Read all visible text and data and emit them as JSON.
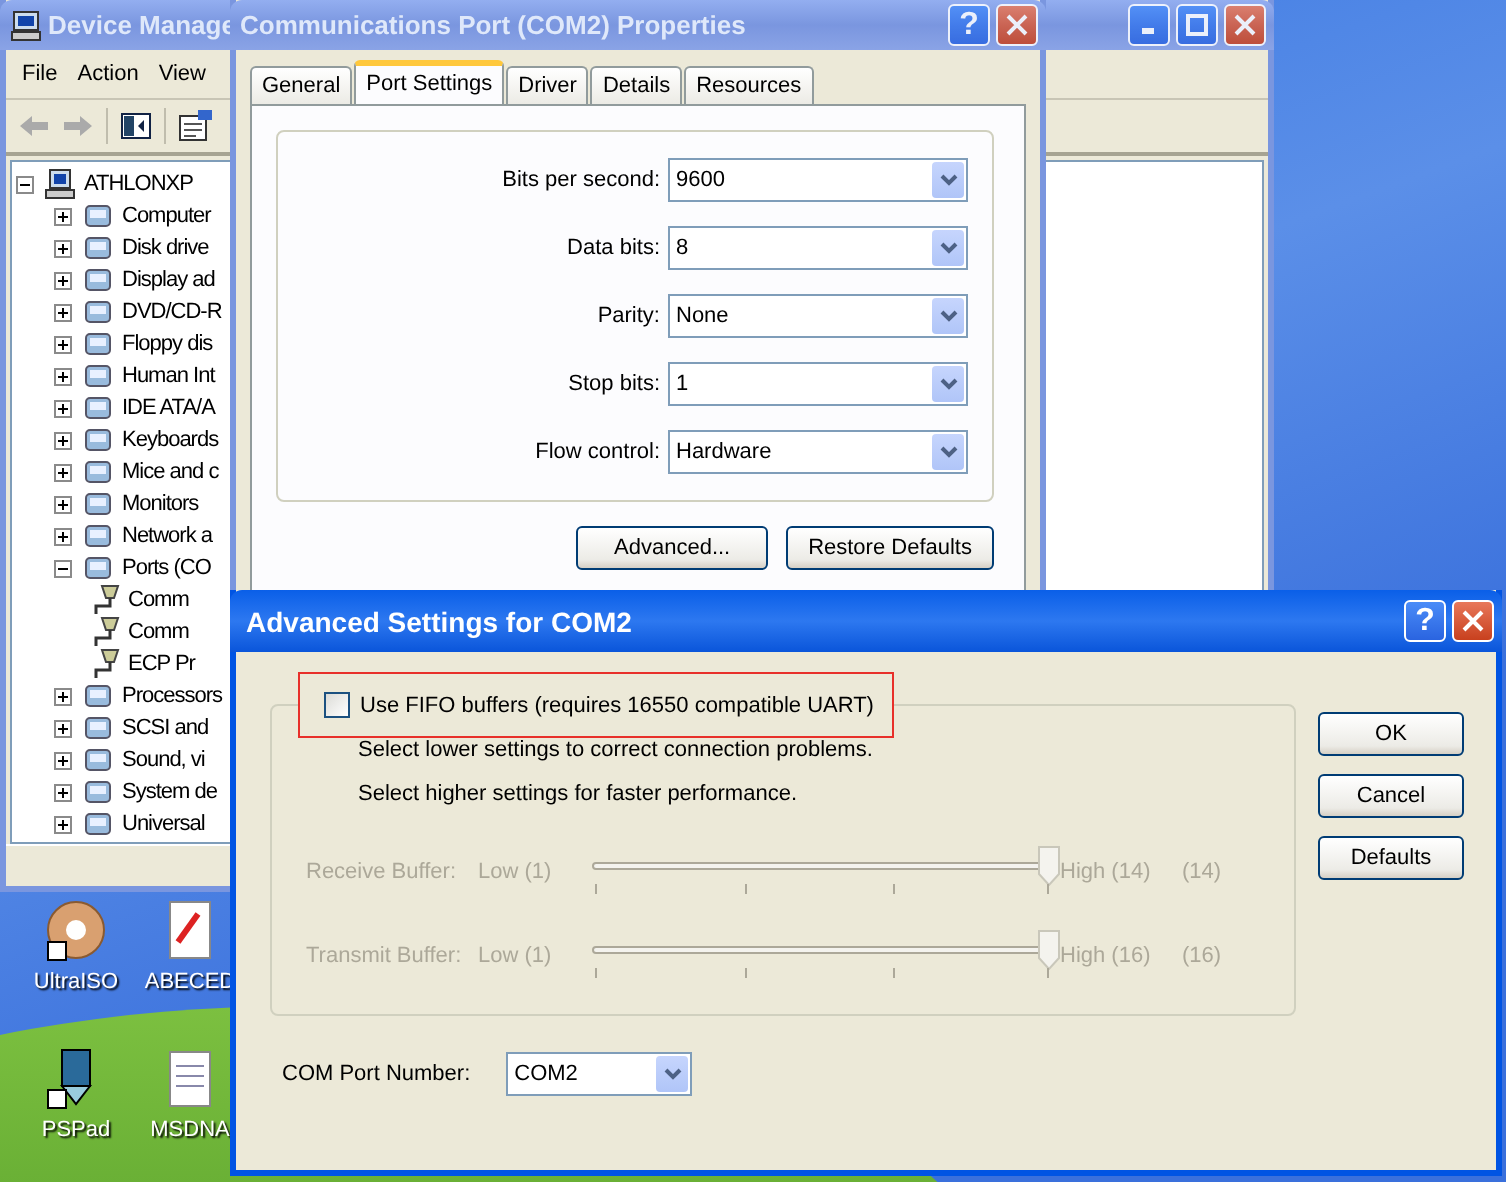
{
  "desktop": {
    "icons": [
      {
        "label": "UltraISO",
        "kind": "disc"
      },
      {
        "label": "ABECED",
        "kind": "document"
      },
      {
        "label": "PSPad",
        "kind": "pen"
      },
      {
        "label": "MSDNA",
        "kind": "notepad"
      }
    ]
  },
  "device_manager": {
    "title": "Device Manage",
    "active": false,
    "menu": [
      "File",
      "Action",
      "View"
    ],
    "tree": {
      "label": "ATHLONXP",
      "expanded": true,
      "children": [
        {
          "label": "Computer",
          "expanded": false
        },
        {
          "label": "Disk drive",
          "expanded": false
        },
        {
          "label": "Display ad",
          "expanded": false
        },
        {
          "label": "DVD/CD-R",
          "expanded": false
        },
        {
          "label": "Floppy dis",
          "expanded": false
        },
        {
          "label": "Human Int",
          "expanded": false
        },
        {
          "label": "IDE ATA/A",
          "expanded": false
        },
        {
          "label": "Keyboards",
          "expanded": false
        },
        {
          "label": "Mice and c",
          "expanded": false
        },
        {
          "label": "Monitors",
          "expanded": false
        },
        {
          "label": "Network a",
          "expanded": false
        },
        {
          "label": "Ports (CO",
          "expanded": true,
          "children": [
            {
              "label": "Comm"
            },
            {
              "label": "Comm"
            },
            {
              "label": "ECP Pr"
            }
          ]
        },
        {
          "label": "Processors",
          "expanded": false
        },
        {
          "label": "SCSI and",
          "expanded": false
        },
        {
          "label": "Sound, vi",
          "expanded": false
        },
        {
          "label": "System de",
          "expanded": false
        },
        {
          "label": "Universal",
          "expanded": false
        }
      ]
    }
  },
  "properties": {
    "title": "Communications Port (COM2) Properties",
    "active": false,
    "help": "?",
    "tabs": [
      {
        "label": "General",
        "selected": false
      },
      {
        "label": "Port Settings",
        "selected": true
      },
      {
        "label": "Driver",
        "selected": false
      },
      {
        "label": "Details",
        "selected": false
      },
      {
        "label": "Resources",
        "selected": false
      }
    ],
    "fields": [
      {
        "label": "Bits per second:",
        "value": "9600"
      },
      {
        "label": "Data bits:",
        "value": "8"
      },
      {
        "label": "Parity:",
        "value": "None"
      },
      {
        "label": "Stop bits:",
        "value": "1"
      },
      {
        "label": "Flow control:",
        "value": "Hardware"
      }
    ],
    "buttons": [
      "Advanced...",
      "Restore Defaults"
    ]
  },
  "advanced": {
    "title": "Advanced Settings for COM2",
    "active": true,
    "help": "?",
    "fifo": {
      "label": "Use FIFO buffers (requires 16550 compatible UART)",
      "checked": false,
      "highlighted": true
    },
    "hints": [
      "Select lower settings to correct connection problems.",
      "Select higher settings for faster performance."
    ],
    "sliders": [
      {
        "label": "Receive Buffer:",
        "low": "Low (1)",
        "high": "High (14)",
        "reading": "(14)",
        "level": 1,
        "disabled": true
      },
      {
        "label": "Transmit Buffer:",
        "low": "Low (1)",
        "high": "High (16)",
        "reading": "(16)",
        "level": 1,
        "disabled": true
      }
    ],
    "buttons": [
      "OK",
      "Cancel",
      "Defaults"
    ],
    "port": {
      "label": "COM Port Number:",
      "value": "COM2"
    }
  }
}
